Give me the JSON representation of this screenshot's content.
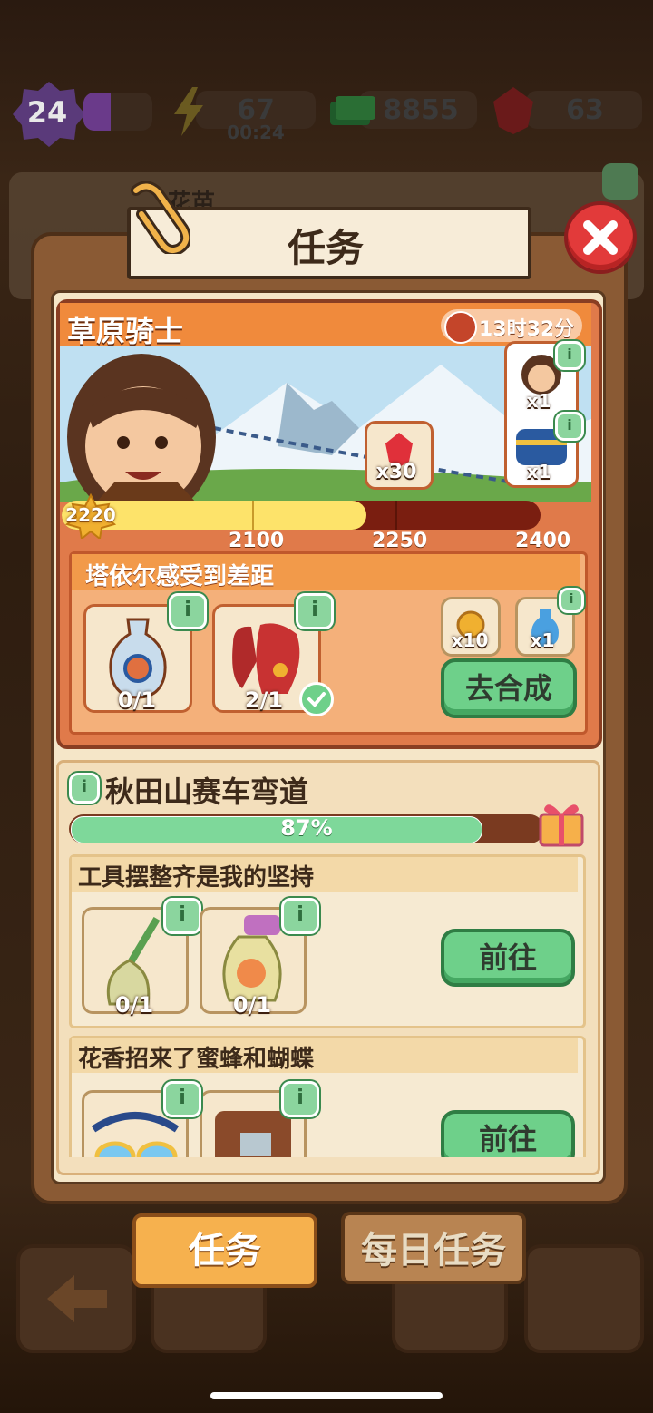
{
  "topbar": {
    "level": "24",
    "energy": "67",
    "energy_timer": "00:24",
    "cash": "8855",
    "gems": "63"
  },
  "background": {
    "panel_text": "花苗"
  },
  "dialog": {
    "title": "任务"
  },
  "event": {
    "title": "草原骑士",
    "timer": "13时32分",
    "current_points": "2220",
    "points_max": 2400,
    "points_min": 2000,
    "milestones": [
      "2100",
      "2250",
      "2400"
    ],
    "reward_gem_count": "x30",
    "reward_char_count": "x1",
    "reward_chest_count": "x1"
  },
  "event_quest": {
    "title": "塔依尔感受到差距",
    "items": [
      {
        "count": "0/1",
        "icon": "vase-icon"
      },
      {
        "count": "2/1",
        "icon": "red-gloves-icon"
      }
    ],
    "rewards": [
      {
        "count": "x10",
        "icon": "gold-badge-icon"
      },
      {
        "count": "x1",
        "icon": "potion-bottle-icon"
      }
    ],
    "button": "去合成"
  },
  "chapter": {
    "title": "秋田山赛车弯道",
    "progress_text": "87%",
    "progress": 0.87
  },
  "tasks": [
    {
      "title": "工具摆整齐是我的坚持",
      "items": [
        {
          "count": "0/1",
          "icon": "broom-icon"
        },
        {
          "count": "0/1",
          "icon": "spray-bottle-icon"
        }
      ],
      "button": "前往"
    },
    {
      "title": "花香招来了蜜蜂和蝴蝶",
      "items": [
        {
          "count": "",
          "icon": "sunglasses-icon"
        },
        {
          "count": "",
          "icon": "leather-bag-icon"
        }
      ],
      "button": "前往"
    }
  ],
  "tabs": {
    "tasks": "任务",
    "daily": "每日任务"
  },
  "colors": {
    "accent_green": "#6ed08a",
    "event_orange": "#f08a3c",
    "close_red": "#e23a3a"
  }
}
